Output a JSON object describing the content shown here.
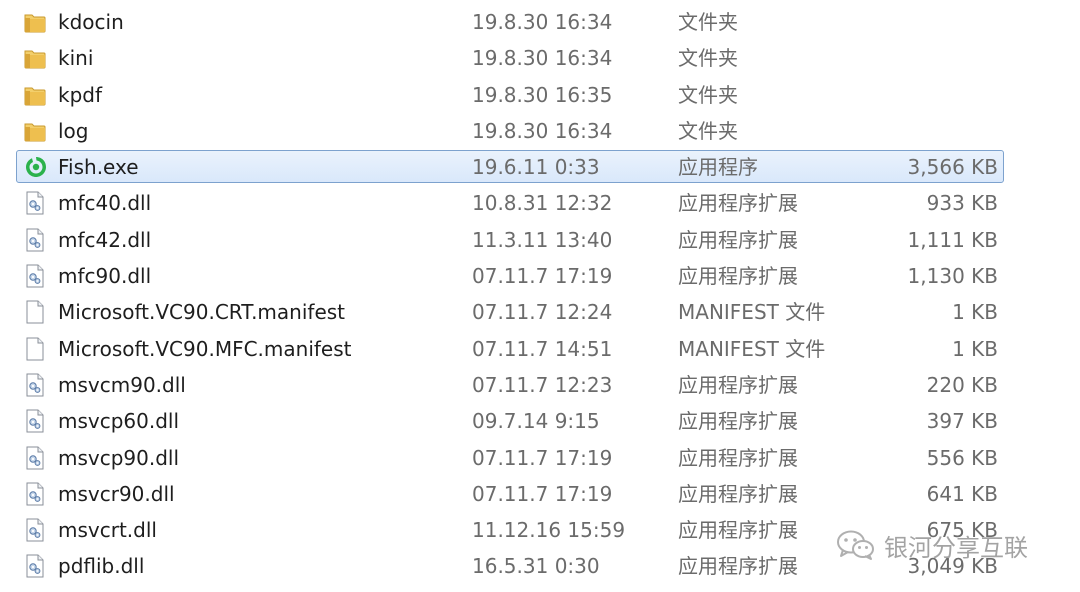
{
  "files": [
    {
      "name": "kdocin",
      "date": "19.8.30 16:34",
      "type": "文件夹",
      "size": "",
      "icon": "folder-icon"
    },
    {
      "name": "kini",
      "date": "19.8.30 16:34",
      "type": "文件夹",
      "size": "",
      "icon": "folder-icon"
    },
    {
      "name": "kpdf",
      "date": "19.8.30 16:35",
      "type": "文件夹",
      "size": "",
      "icon": "folder-icon"
    },
    {
      "name": "log",
      "date": "19.8.30 16:34",
      "type": "文件夹",
      "size": "",
      "icon": "folder-icon"
    },
    {
      "name": "Fish.exe",
      "date": "19.6.11 0:33",
      "type": "应用程序",
      "size": "3,566 KB",
      "icon": "fish-app-icon",
      "selected": true
    },
    {
      "name": "mfc40.dll",
      "date": "10.8.31 12:32",
      "type": "应用程序扩展",
      "size": "933 KB",
      "icon": "dll-icon"
    },
    {
      "name": "mfc42.dll",
      "date": "11.3.11 13:40",
      "type": "应用程序扩展",
      "size": "1,111 KB",
      "icon": "dll-icon"
    },
    {
      "name": "mfc90.dll",
      "date": "07.11.7 17:19",
      "type": "应用程序扩展",
      "size": "1,130 KB",
      "icon": "dll-icon"
    },
    {
      "name": "Microsoft.VC90.CRT.manifest",
      "date": "07.11.7 12:24",
      "type": "MANIFEST 文件",
      "size": "1 KB",
      "icon": "blank-file-icon"
    },
    {
      "name": "Microsoft.VC90.MFC.manifest",
      "date": "07.11.7 14:51",
      "type": "MANIFEST 文件",
      "size": "1 KB",
      "icon": "blank-file-icon"
    },
    {
      "name": "msvcm90.dll",
      "date": "07.11.7 12:23",
      "type": "应用程序扩展",
      "size": "220 KB",
      "icon": "dll-icon"
    },
    {
      "name": "msvcp60.dll",
      "date": "09.7.14 9:15",
      "type": "应用程序扩展",
      "size": "397 KB",
      "icon": "dll-icon"
    },
    {
      "name": "msvcp90.dll",
      "date": "07.11.7 17:19",
      "type": "应用程序扩展",
      "size": "556 KB",
      "icon": "dll-icon"
    },
    {
      "name": "msvcr90.dll",
      "date": "07.11.7 17:19",
      "type": "应用程序扩展",
      "size": "641 KB",
      "icon": "dll-icon"
    },
    {
      "name": "msvcrt.dll",
      "date": "11.12.16 15:59",
      "type": "应用程序扩展",
      "size": "675 KB",
      "icon": "dll-icon"
    },
    {
      "name": "pdflib.dll",
      "date": "16.5.31 0:30",
      "type": "应用程序扩展",
      "size": "3,049 KB",
      "icon": "dll-icon"
    }
  ],
  "watermark": {
    "text": "银河分享互联",
    "icon": "wechat-icon"
  },
  "colors": {
    "selection_border": "#7da2ce",
    "selection_fill": "#dce9fb",
    "folder": "#e8b84a",
    "fish_app": "#2bb24c"
  }
}
